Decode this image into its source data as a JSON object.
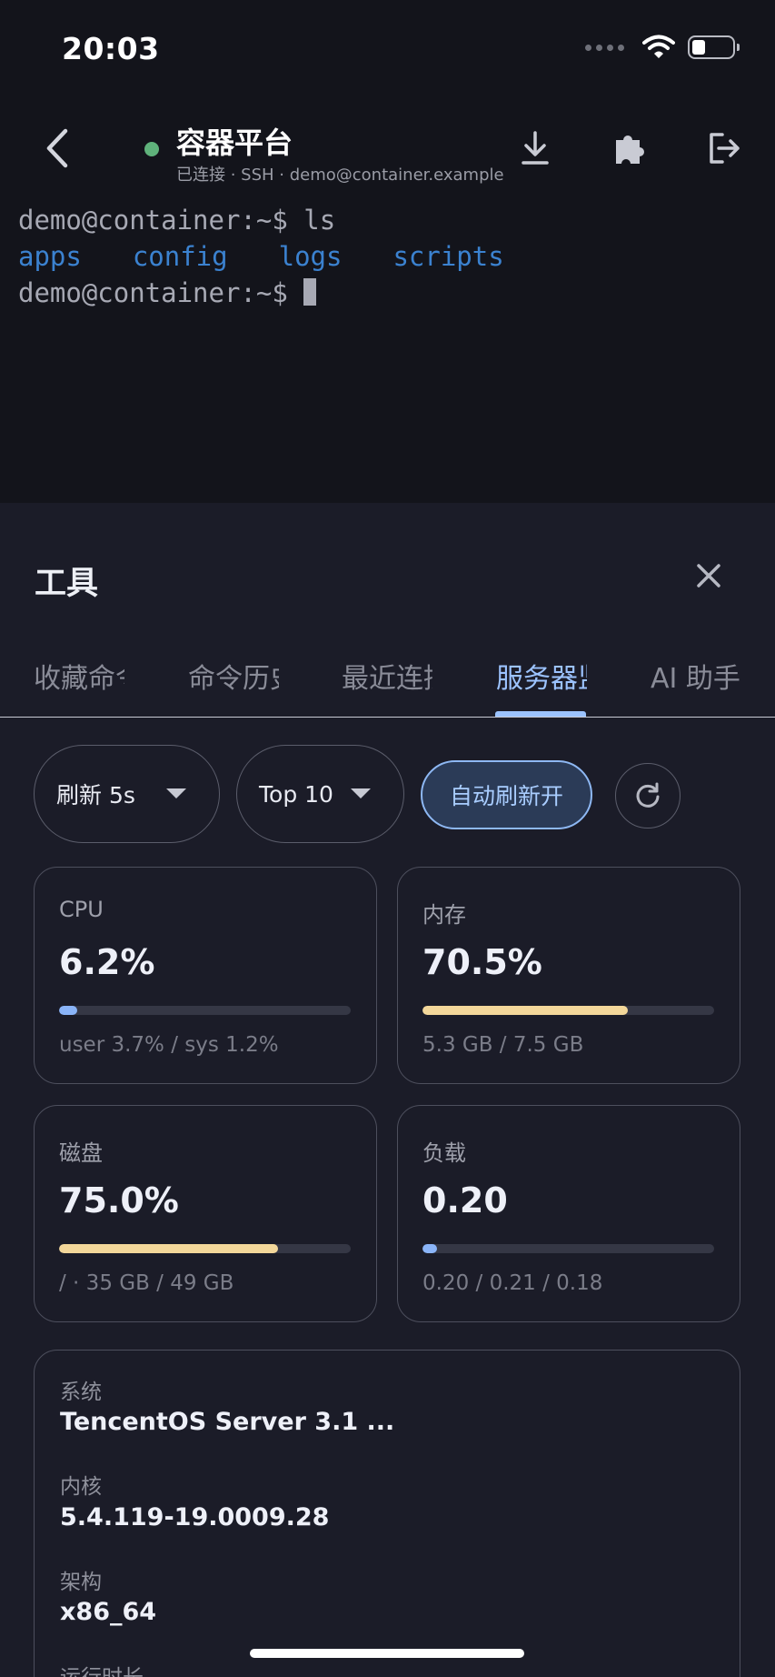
{
  "status_bar": {
    "time": "20:03"
  },
  "header": {
    "title": "容器平台",
    "subtitle": "已连接 · SSH · demo@container.example"
  },
  "terminal": {
    "line1": "demo@container:~$ ls",
    "dirs": [
      "apps",
      "config",
      "logs",
      "scripts"
    ],
    "prompt": "demo@container:~$ "
  },
  "sheet": {
    "title": "工具",
    "tabs": [
      "收藏命令",
      "命令历史",
      "最近连接",
      "服务器监控",
      "AI 助手"
    ],
    "active_tab": "服务器监控"
  },
  "toolbar": {
    "refresh_select": "刷新 5s",
    "top_select": "Top 10",
    "auto_refresh": "自动刷新开"
  },
  "metrics": {
    "cpu": {
      "label": "CPU",
      "value": "6.2%",
      "percent": 6.2,
      "detail": "user 3.7% / sys 1.2%"
    },
    "memory": {
      "label": "内存",
      "value": "70.5%",
      "percent": 70.5,
      "detail": "5.3 GB / 7.5 GB"
    },
    "disk": {
      "label": "磁盘",
      "value": "75.0%",
      "percent": 75.0,
      "detail": "/ · 35 GB / 49 GB"
    },
    "load": {
      "label": "负载",
      "value": "0.20",
      "percent": 5,
      "detail": "0.20 / 0.21 / 0.18"
    }
  },
  "system_info": {
    "os_label": "系统",
    "os_value": "TencentOS Server 3.1 ...",
    "kernel_label": "内核",
    "kernel_value": "5.4.119-19.0009.28",
    "arch_label": "架构",
    "arch_value": "x86_64",
    "uptime_label": "运行时长"
  },
  "colors": {
    "accent": "#9cc3ff",
    "bar_blue": "#8ab4f8",
    "bar_yellow": "#f3d79a",
    "status_online": "#5fb27b"
  },
  "icons": [
    "back-arrow-icon",
    "download-icon",
    "puzzle-icon",
    "logout-icon",
    "close-icon",
    "refresh-icon",
    "wifi-icon",
    "battery-icon"
  ]
}
